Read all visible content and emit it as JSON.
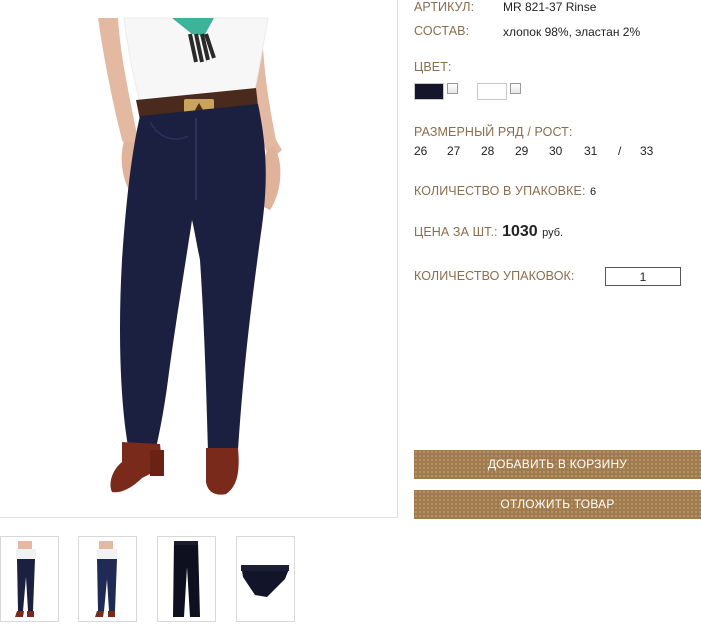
{
  "product": {
    "article_label": "АРТИКУЛ:",
    "article_value": "MR 821-37 Rinse",
    "composition_label": "СОСТАВ:",
    "composition_value": "хлопок 98%, эластан 2%",
    "color_label": "ЦВЕТ:",
    "colors": [
      {
        "name": "dark-navy",
        "hex": "#15162b",
        "checked": false
      },
      {
        "name": "white",
        "hex": "#ffffff",
        "checked": false
      }
    ],
    "size_label": "РАЗМЕРНЫЙ РЯД / РОСТ:",
    "sizes": [
      "26",
      "27",
      "28",
      "29",
      "30",
      "31",
      "/",
      "33"
    ],
    "pack_qty_label": "КОЛИЧЕСТВО В УПАКОВКЕ:",
    "pack_qty_value": "6",
    "price_label": "ЦЕНА ЗА ШТ.:",
    "price_value": "1030",
    "price_currency": "руб.",
    "packs_label": "КОЛИЧЕСТВО УПАКОВОК:",
    "packs_value": "1"
  },
  "actions": {
    "add_to_cart": "ДОБАВИТЬ В КОРЗИНУ",
    "postpone": "ОТЛОЖИТЬ ТОВАР"
  },
  "gallery": {
    "thumbnails": [
      {
        "name": "front-view"
      },
      {
        "name": "back-view"
      },
      {
        "name": "flat-front"
      },
      {
        "name": "folded"
      }
    ]
  },
  "colors": {
    "label": "#8a6d4d",
    "button": "#a17b4c",
    "denim": "#1c2040"
  }
}
